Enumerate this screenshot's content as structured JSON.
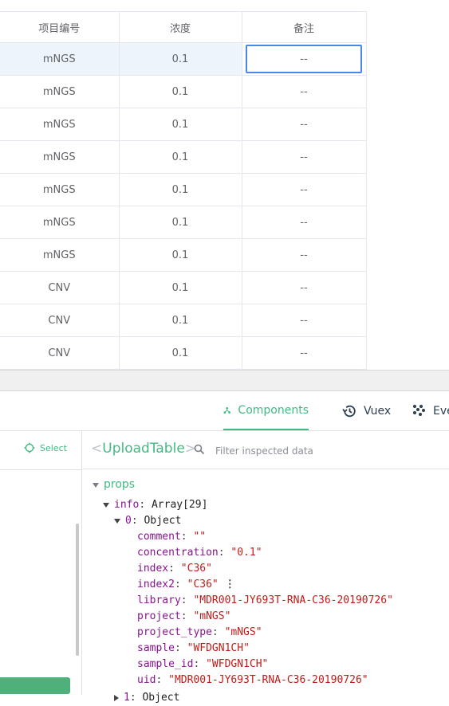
{
  "table": {
    "headers": [
      "项目编号",
      "浓度",
      "备注"
    ],
    "rows": [
      {
        "project": "mNGS",
        "concentration": "0.1",
        "comment": "--"
      },
      {
        "project": "mNGS",
        "concentration": "0.1",
        "comment": "--"
      },
      {
        "project": "mNGS",
        "concentration": "0.1",
        "comment": "--"
      },
      {
        "project": "mNGS",
        "concentration": "0.1",
        "comment": "--"
      },
      {
        "project": "mNGS",
        "concentration": "0.1",
        "comment": "--"
      },
      {
        "project": "mNGS",
        "concentration": "0.1",
        "comment": "--"
      },
      {
        "project": "mNGS",
        "concentration": "0.1",
        "comment": "--"
      },
      {
        "project": "CNV",
        "concentration": "0.1",
        "comment": "--"
      },
      {
        "project": "CNV",
        "concentration": "0.1",
        "comment": "--"
      },
      {
        "project": "CNV",
        "concentration": "0.1",
        "comment": "--"
      }
    ],
    "editing_value": "--"
  },
  "devtools": {
    "tabs": {
      "components": "Components",
      "vuex": "Vuex",
      "events": "Events"
    },
    "select_label": "Select",
    "component_name": "UploadTable",
    "bracket_open": "<",
    "bracket_close": ">",
    "filter_placeholder": "Filter inspected data",
    "props_label": "props",
    "info_key": "info",
    "info_value": "Array[29]",
    "item0_key": "0",
    "item0_value": "Object",
    "fields": [
      {
        "key": "comment",
        "value": "\"\""
      },
      {
        "key": "concentration",
        "value": "\"0.1\""
      },
      {
        "key": "index",
        "value": "\"C36\""
      },
      {
        "key": "index2",
        "value": "\"C36\""
      },
      {
        "key": "library",
        "value": "\"MDR001-JY693T-RNA-C36-20190726\""
      },
      {
        "key": "project",
        "value": "\"mNGS\""
      },
      {
        "key": "project_type",
        "value": "\"mNGS\""
      },
      {
        "key": "sample",
        "value": "\"WFDGN1CH\""
      },
      {
        "key": "sample_id",
        "value": "\"WFDGN1CH\""
      },
      {
        "key": "uid",
        "value": "\"MDR001-JY693T-RNA-C36-20190726\""
      }
    ],
    "item1_key": "1",
    "item1_value": "Object",
    "colors": {
      "accent": "#42b983",
      "key": "#881391",
      "string": "#c41a16",
      "selection": "#4a87e8"
    }
  }
}
